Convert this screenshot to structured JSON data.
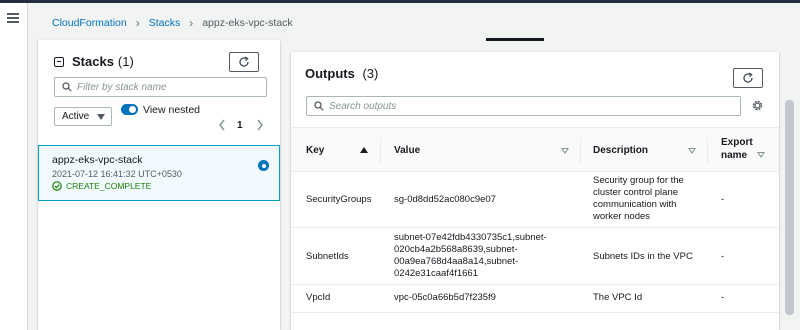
{
  "breadcrumb": {
    "items": [
      "CloudFormation",
      "Stacks"
    ],
    "current": "appz-eks-vpc-stack"
  },
  "stacks_panel": {
    "title": "Stacks",
    "count": "(1)",
    "filter_placeholder": "Filter by stack name",
    "status_filter": "Active",
    "view_nested_label": "View nested",
    "view_nested_enabled": true,
    "page": "1",
    "items": [
      {
        "name": "appz-eks-vpc-stack",
        "date": "2021-07-12 16:41:32 UTC+0530",
        "status": "CREATE_COMPLETE",
        "selected": true
      }
    ]
  },
  "outputs_panel": {
    "title": "Outputs",
    "count": "(3)",
    "search_placeholder": "Search outputs",
    "columns": {
      "key": "Key",
      "value": "Value",
      "description": "Description",
      "export_line1": "Export",
      "export_line2": "name"
    },
    "rows": [
      {
        "key": "SecurityGroups",
        "value": [
          "sg-0d8dd52ac080c9e07"
        ],
        "description": [
          "Security group for the",
          "cluster control plane",
          "communication with",
          "worker nodes"
        ],
        "export": "-"
      },
      {
        "key": "SubnetIds",
        "value": [
          "subnet-07e42fdb4330735c1,subnet-",
          "020cb4a2b568a8639,subnet-",
          "00a9ea768d4aa8a14,subnet-",
          "0242e31caaf4f1661"
        ],
        "description": [
          "Subnets IDs in the VPC"
        ],
        "export": "-"
      },
      {
        "key": "VpcId",
        "value": [
          "vpc-05c0a66b5d7f235f9"
        ],
        "description": [
          "The VPC Id"
        ],
        "export": "-"
      }
    ]
  },
  "colors": {
    "link": "#0073bb",
    "success": "#1d8102",
    "selected_border": "#00a1c9",
    "selected_bg": "#f1faff"
  }
}
